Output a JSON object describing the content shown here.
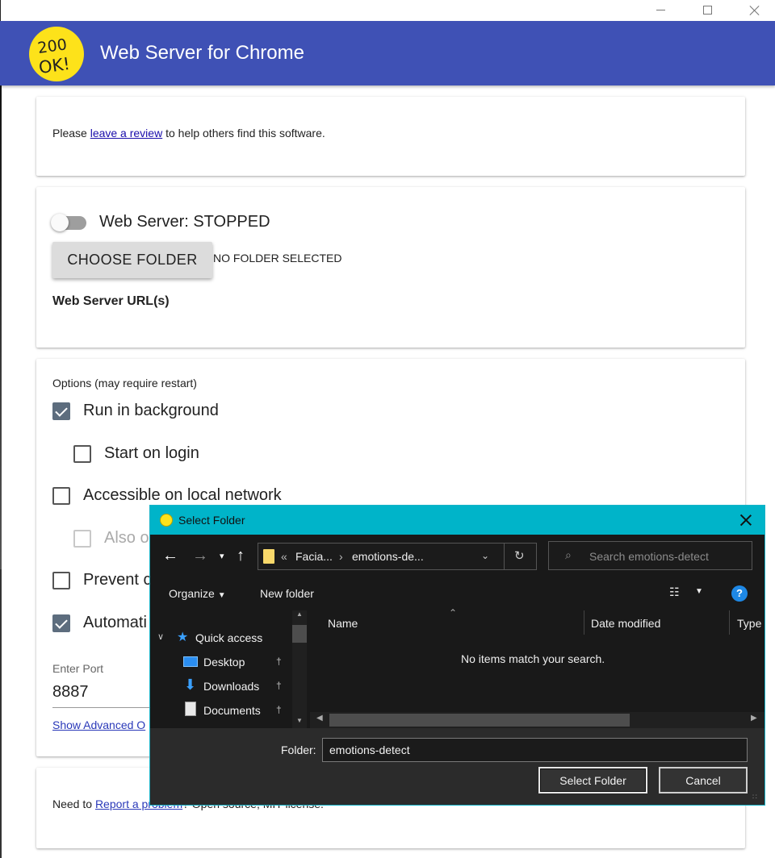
{
  "app": {
    "title": "Web Server for Chrome",
    "logo_text": "200 OK!"
  },
  "review_card": {
    "prefix": "Please ",
    "link": "leave a review",
    "suffix": " to help others find this software."
  },
  "server_card": {
    "status": "Web Server: STOPPED",
    "choose_folder_label": "CHOOSE FOLDER",
    "folder_status": "NO FOLDER SELECTED",
    "urls_heading": "Web Server URL(s)"
  },
  "options_card": {
    "heading": "Options (may require restart)",
    "options": [
      {
        "label": "Run in background",
        "checked": true
      },
      {
        "label": "Start on login",
        "checked": false
      },
      {
        "label": "Accessible on local network",
        "checked": false
      },
      {
        "label": "Also o",
        "checked": false,
        "disabled": true
      },
      {
        "label": "Prevent c",
        "checked": false
      },
      {
        "label": "Automati",
        "checked": true
      }
    ],
    "port_label": "Enter Port",
    "port_value": "8887",
    "advanced_link": "Show Advanced O"
  },
  "footer_card": {
    "prefix": "Need to ",
    "link": "Report a problem",
    "suffix": "? Open source, MIT license."
  },
  "dialog": {
    "title": "Select Folder",
    "breadcrumb": [
      "«",
      "Facia...",
      "›",
      "emotions-de..."
    ],
    "search_placeholder": "Search emotions-detect",
    "organize_label": "Organize",
    "new_folder_label": "New folder",
    "help_label": "?",
    "nav_pane": [
      "Quick access",
      "Desktop",
      "Downloads",
      "Documents"
    ],
    "columns": [
      "Name",
      "Date modified",
      "Type"
    ],
    "empty_message": "No items match your search.",
    "folder_label": "Folder:",
    "folder_value": "emotions-detect",
    "select_button": "Select Folder",
    "cancel_button": "Cancel"
  },
  "colors": {
    "appbar": "#3f51b5",
    "dialog_title": "#00b4c9",
    "logo": "#fde21a",
    "checkbox_checked": "#5d6d7e"
  }
}
